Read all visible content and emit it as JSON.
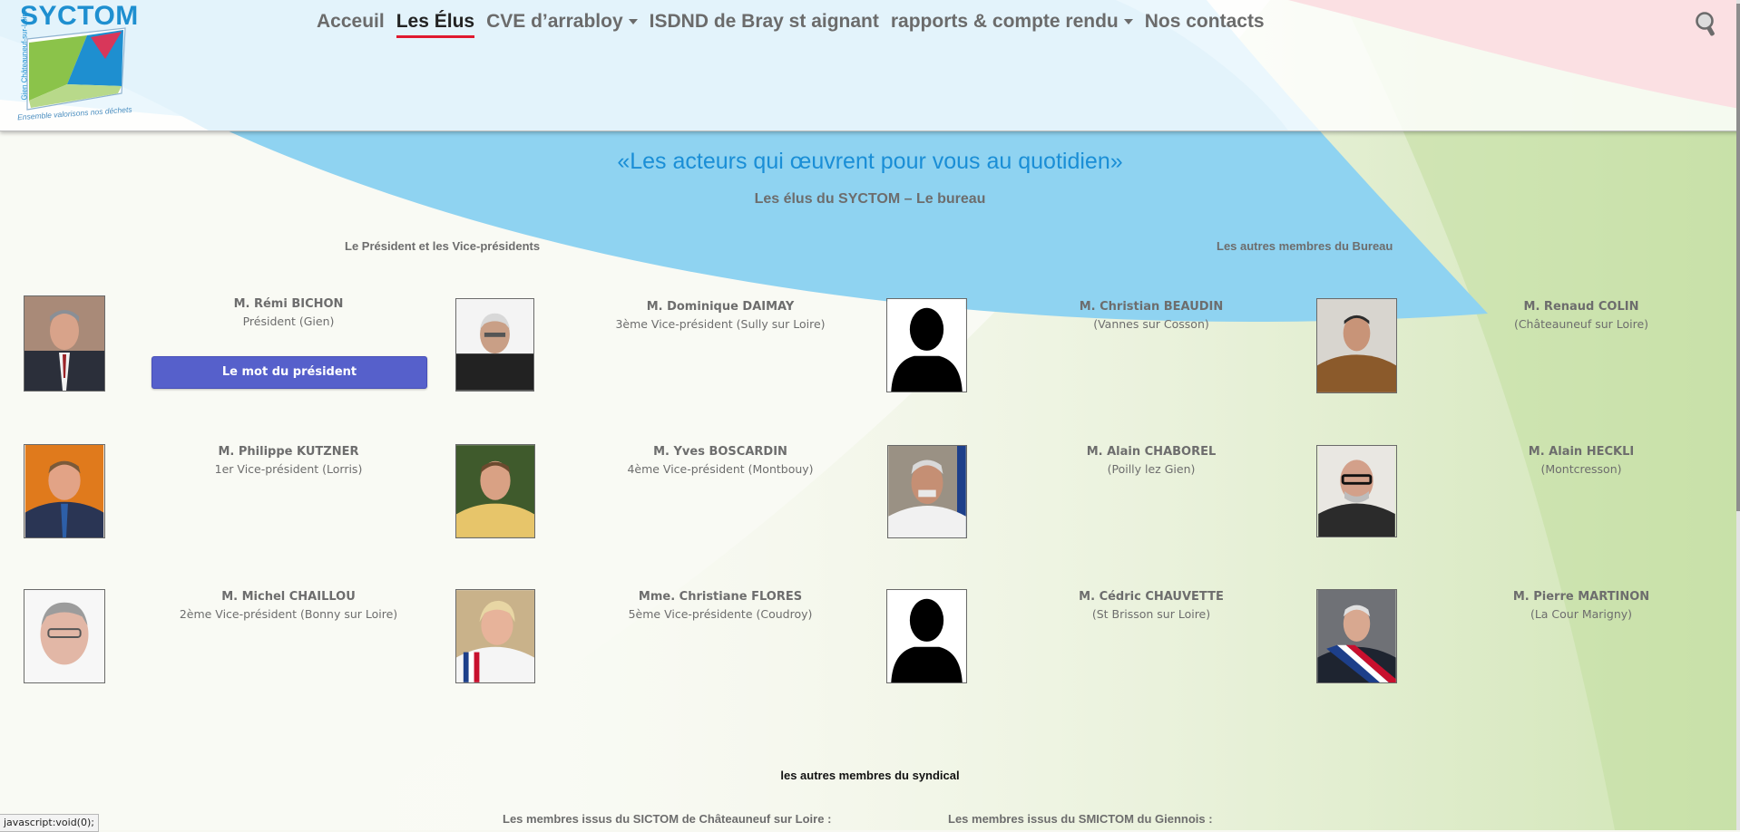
{
  "logo": {
    "title": "SYCTOM",
    "vertical_text": "Gien Châteauneuf-sur-Loire",
    "tagline": "Ensemble valorisons nos déchets"
  },
  "nav": {
    "items": [
      {
        "label": "Acceuil",
        "active": false,
        "dropdown": false
      },
      {
        "label": "Les Élus",
        "active": true,
        "dropdown": false
      },
      {
        "label": "CVE d’arrabloy",
        "active": false,
        "dropdown": true
      },
      {
        "label": "ISDND de Bray st aignant",
        "active": false,
        "dropdown": false
      },
      {
        "label": "rapports & compte rendu",
        "active": false,
        "dropdown": true
      },
      {
        "label": "Nos contacts",
        "active": false,
        "dropdown": false
      }
    ],
    "search_icon": "search-icon"
  },
  "page": {
    "quote": "«Les acteurs qui œuvrent pour vous au quotidien»",
    "subtitle": "Les élus du SYCTOM – Le bureau",
    "section_left": "Le Président et les Vice-présidents",
    "section_right": "Les autres membres du Bureau",
    "president_button": "Le mot du président",
    "others_title": "les autres membres du syndical",
    "sub_left": "Les membres issus du SICTOM de Châteauneuf sur Loire :",
    "sub_right": "Les membres issus du SMICTOM du Giennois :"
  },
  "members": [
    {
      "name": "M. Rémi BICHON",
      "role": "Président (Gien)",
      "photo": "portrait-photo"
    },
    {
      "name": "M. Dominique DAIMAY",
      "role": "3ème Vice-président (Sully sur Loire)",
      "photo": "portrait-photo"
    },
    {
      "name": "M. Christian BEAUDIN",
      "role": "(Vannes sur Cosson)",
      "photo": "silhouette"
    },
    {
      "name": "M. Renaud COLIN",
      "role": "(Châteauneuf sur Loire)",
      "photo": "portrait-photo"
    },
    {
      "name": "M. Philippe KUTZNER",
      "role": "1er Vice-président (Lorris)",
      "photo": "portrait-photo"
    },
    {
      "name": "M. Yves BOSCARDIN",
      "role": "4ème Vice-président (Montbouy)",
      "photo": "portrait-photo"
    },
    {
      "name": "M. Alain CHABOREL",
      "role": "(Poilly lez Gien)",
      "photo": "portrait-photo"
    },
    {
      "name": "M. Alain HECKLI",
      "role": "(Montcresson)",
      "photo": "portrait-photo"
    },
    {
      "name": "M. Michel CHAILLOU",
      "role": "2ème Vice-président (Bonny sur Loire)",
      "photo": "portrait-photo"
    },
    {
      "name": "Mme. Christiane FLORES",
      "role": "5ème Vice-présidente (Coudroy)",
      "photo": "portrait-photo"
    },
    {
      "name": "M. Cédric CHAUVETTE",
      "role": "(St Brisson sur Loire)",
      "photo": "silhouette"
    },
    {
      "name": "M. Pierre MARTINON",
      "role": "(La Cour Marigny)",
      "photo": "portrait-photo"
    }
  ],
  "status_bar": "javascript:void(0);",
  "colors": {
    "accent_blue": "#1a8ed6",
    "button_blue": "#5660cb",
    "active_underline": "#e0192f",
    "swoosh_blue": "#8fd3f1"
  }
}
